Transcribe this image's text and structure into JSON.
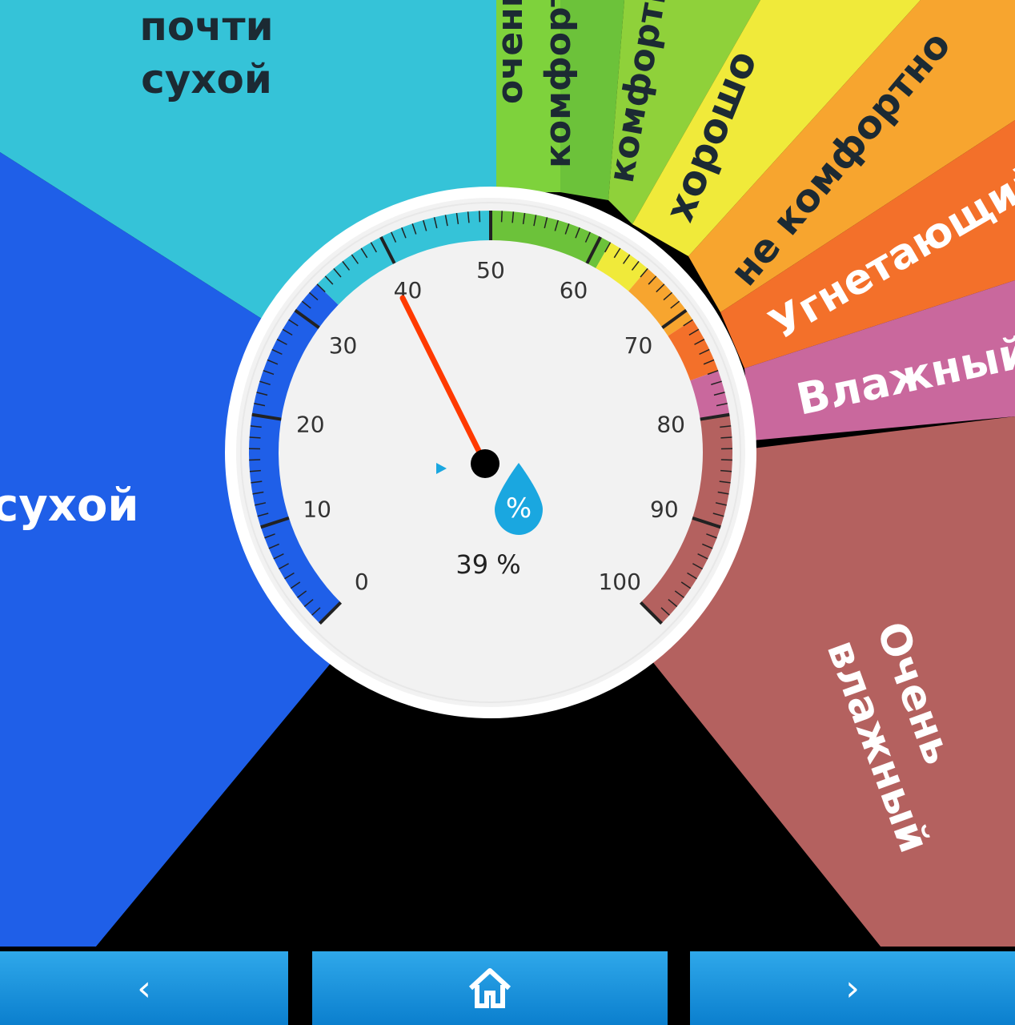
{
  "zones": [
    {
      "label": "почти\nсухой",
      "color": "#35c3d8"
    },
    {
      "label": "сухой",
      "color": "#1f5fe8"
    },
    {
      "label": "очень",
      "color": "#7ed23c"
    },
    {
      "label": "комфортно",
      "color": "#6cc23a"
    },
    {
      "label": "комфортно",
      "color": "#8fd13a"
    },
    {
      "label": "хорошо",
      "color": "#f0ea3a"
    },
    {
      "label": "не комфортно",
      "color": "#f7a52f"
    },
    {
      "label": "Угнетающий",
      "color": "#f3702a"
    },
    {
      "label": "Влажный",
      "color": "#c9689d"
    },
    {
      "label": "Очень\nвлажный",
      "color": "#b4615f"
    }
  ],
  "gauge": {
    "min": 0,
    "max": 100,
    "value": 39,
    "value_text": "39 %",
    "tick_labels": [
      "0",
      "10",
      "20",
      "30",
      "40",
      "50",
      "60",
      "70",
      "80",
      "90",
      "100"
    ],
    "icon": "humidity-drop-icon",
    "needle_color": "#ff3a00",
    "bands": [
      {
        "from": 0,
        "to": 33,
        "color": "#1f5fe8"
      },
      {
        "from": 33,
        "to": 50,
        "color": "#35c3d8"
      },
      {
        "from": 50,
        "to": 61,
        "color": "#6cc23a"
      },
      {
        "from": 61,
        "to": 65,
        "color": "#f0ea3a"
      },
      {
        "from": 65,
        "to": 71,
        "color": "#f7a52f"
      },
      {
        "from": 71,
        "to": 76,
        "color": "#f3702a"
      },
      {
        "from": 76,
        "to": 80,
        "color": "#c9689d"
      },
      {
        "from": 80,
        "to": 100,
        "color": "#b4615f"
      }
    ]
  },
  "nav": {
    "prev_label": "‹",
    "home_icon": "home-icon",
    "next_label": "›",
    "button_color": "#1a93dc"
  }
}
